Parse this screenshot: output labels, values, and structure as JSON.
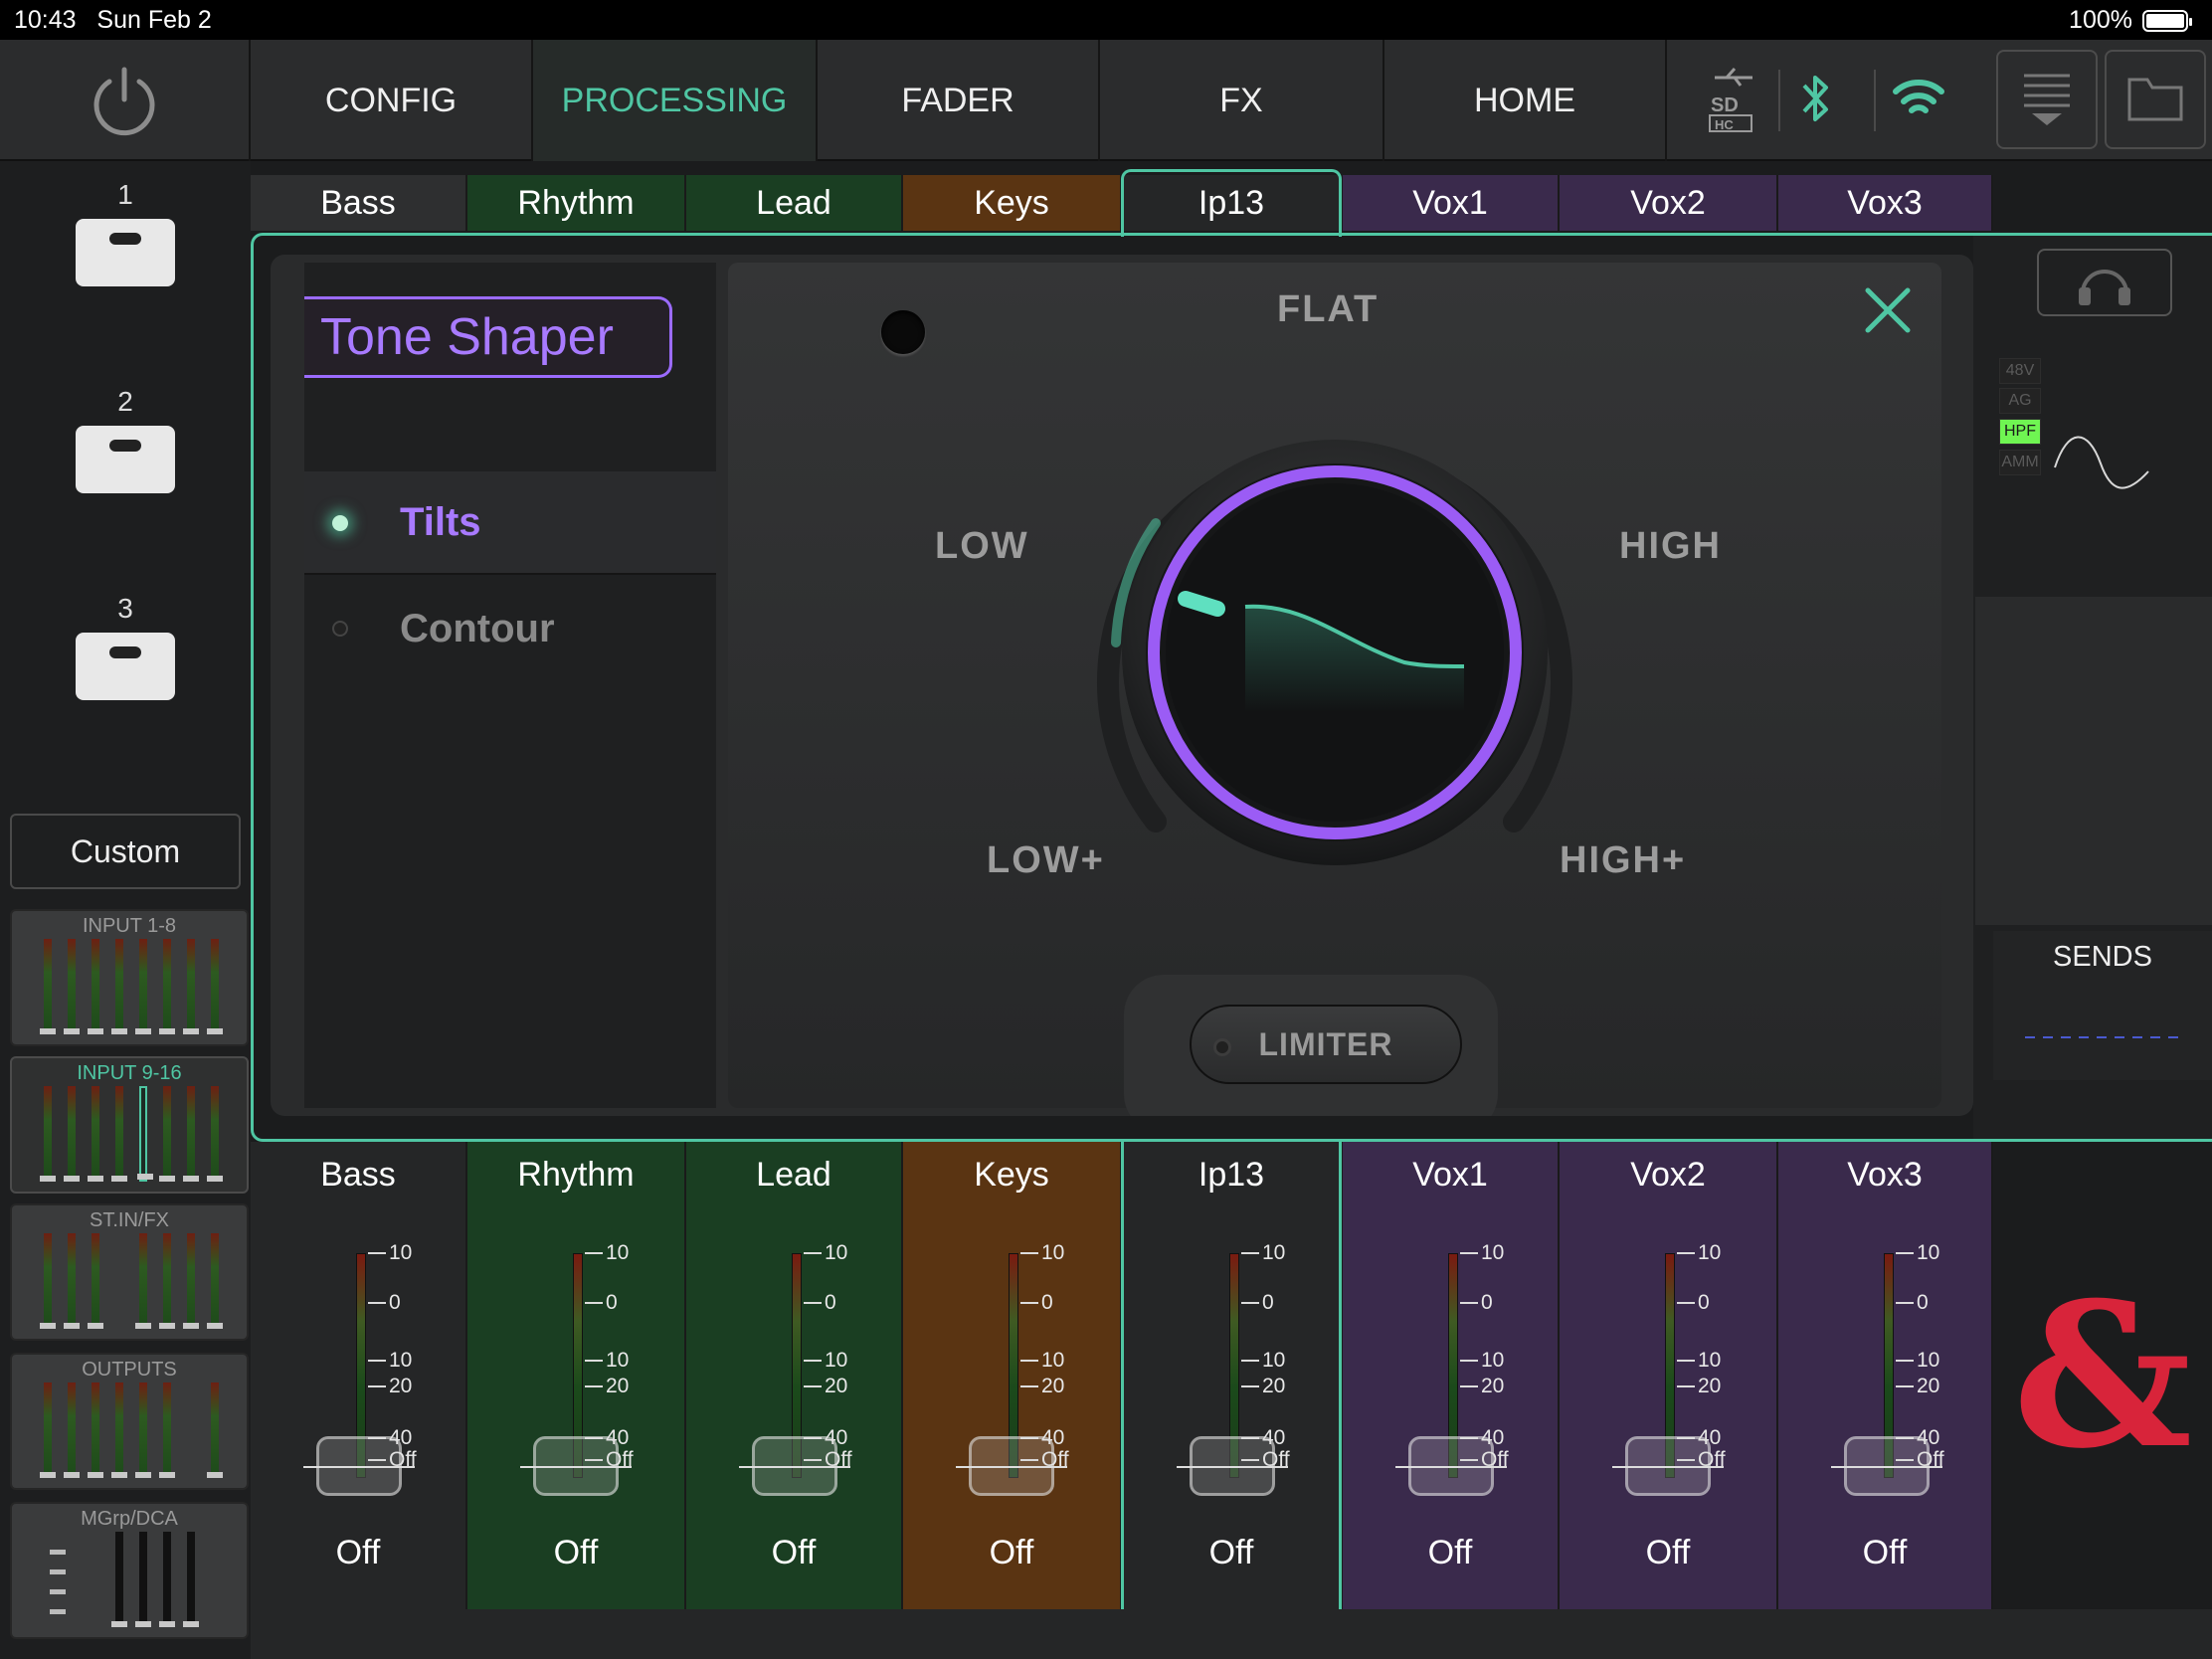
{
  "status_bar": {
    "time": "10:43",
    "date": "Sun Feb 2",
    "battery": "100%"
  },
  "nav": {
    "tabs": [
      {
        "label": "CONFIG"
      },
      {
        "label": "PROCESSING"
      },
      {
        "label": "FADER"
      },
      {
        "label": "FX"
      },
      {
        "label": "HOME"
      }
    ],
    "active_tab": "PROCESSING",
    "icons": [
      "usb-icon",
      "sdhc-icon",
      "bluetooth-icon",
      "wifi-icon",
      "menu-icon",
      "folder-icon"
    ],
    "accent": "#4fc6a3"
  },
  "sidebar": {
    "layers": [
      "1",
      "2",
      "3"
    ],
    "custom_label": "Custom",
    "banks": [
      {
        "label": "INPUT 1-8"
      },
      {
        "label": "INPUT 9-16"
      },
      {
        "label": "ST.IN/FX"
      },
      {
        "label": "OUTPUTS"
      },
      {
        "label": "MGrp/DCA"
      }
    ],
    "active_bank": "INPUT 9-16"
  },
  "channels": [
    {
      "name": "Bass",
      "value": "Off",
      "color": "#252627"
    },
    {
      "name": "Rhythm",
      "value": "Off",
      "color": "#1a3e22"
    },
    {
      "name": "Lead",
      "value": "Off",
      "color": "#1a3e22"
    },
    {
      "name": "Keys",
      "value": "Off",
      "color": "#5a3412"
    },
    {
      "name": "Ip13",
      "value": "Off",
      "color": "#252627"
    },
    {
      "name": "Vox1",
      "value": "Off",
      "color": "#3a2a4c"
    },
    {
      "name": "Vox2",
      "value": "Off",
      "color": "#3a2a4c"
    },
    {
      "name": "Vox3",
      "value": "Off",
      "color": "#3a2a4c"
    }
  ],
  "selected_channel": "Ip13",
  "fader_scale": [
    "10",
    "0",
    "10",
    "20",
    "40",
    "Off"
  ],
  "tone_shaper": {
    "title": "Tone Shaper",
    "modes": [
      {
        "label": "Tilts",
        "active": true
      },
      {
        "label": "Contour",
        "active": false
      }
    ],
    "knob_labels": {
      "flat": "FLAT",
      "low": "LOW",
      "high": "HIGH",
      "low_plus": "LOW+",
      "high_plus": "HIGH+"
    },
    "limiter_label": "LIMITER",
    "knob_color": "#9b5cf5"
  },
  "right_panel": {
    "tags": [
      {
        "label": "48V",
        "on": false
      },
      {
        "label": "AG",
        "on": false
      },
      {
        "label": "HPF",
        "on": true
      },
      {
        "label": "AMM",
        "on": false
      }
    ],
    "sends_label": "SENDS"
  },
  "logo_text": "&"
}
